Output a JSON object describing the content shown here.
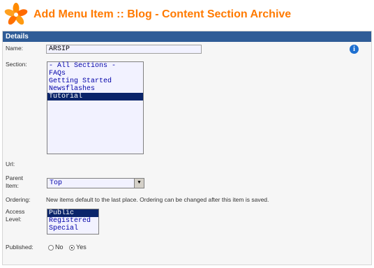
{
  "header": {
    "title": "Add Menu Item :: Blog - Content Section Archive",
    "logo_icon": "joomla-star-icon",
    "title_color": "#ff7a00"
  },
  "details": {
    "header": "Details",
    "header_color": "#2f5c97",
    "name_label": "Name:",
    "name_value": "ARSIP",
    "info_icon": "i",
    "section_label": "Section:",
    "sections": [
      {
        "label": "- All Sections -",
        "selected": false
      },
      {
        "label": "FAQs",
        "selected": false
      },
      {
        "label": "Getting Started",
        "selected": false
      },
      {
        "label": "Newsflashes",
        "selected": false
      },
      {
        "label": "Tutorial",
        "selected": true
      }
    ],
    "url_label": "Url:",
    "parent_label_1": "Parent",
    "parent_label_2": "Item:",
    "parent_value": "Top",
    "ordering_label": "Ordering:",
    "ordering_text": "New items default to the last place. Ordering can be changed after this item is saved.",
    "access_label_1": "Access",
    "access_label_2": "Level:",
    "access_options": [
      {
        "label": "Public",
        "selected": true
      },
      {
        "label": "Registered",
        "selected": false
      },
      {
        "label": "Special",
        "selected": false
      }
    ],
    "published_label": "Published:",
    "published_no": "No",
    "published_yes": "Yes",
    "published_value": "Yes"
  }
}
